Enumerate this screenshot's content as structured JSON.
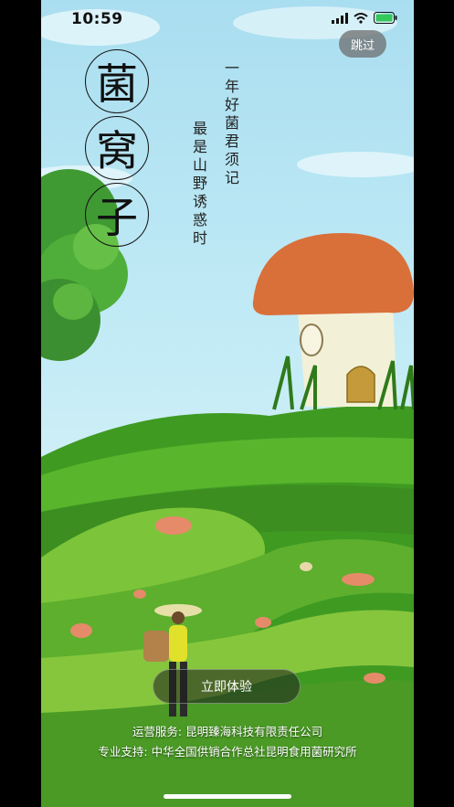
{
  "status_bar": {
    "time": "10:59"
  },
  "skip_label": "跳过",
  "title_chars": [
    "菌",
    "窝",
    "子"
  ],
  "poem": {
    "line1": "一年好菌君须记",
    "line2": "最是山野诱惑时"
  },
  "cta_label": "立即体验",
  "footer": {
    "operator": "运营服务: 昆明臻海科技有限责任公司",
    "support": "专业支持: 中华全国供销合作总社昆明食用菌研究所"
  },
  "icons": [
    "signal-icon",
    "wifi-icon",
    "battery-icon"
  ]
}
